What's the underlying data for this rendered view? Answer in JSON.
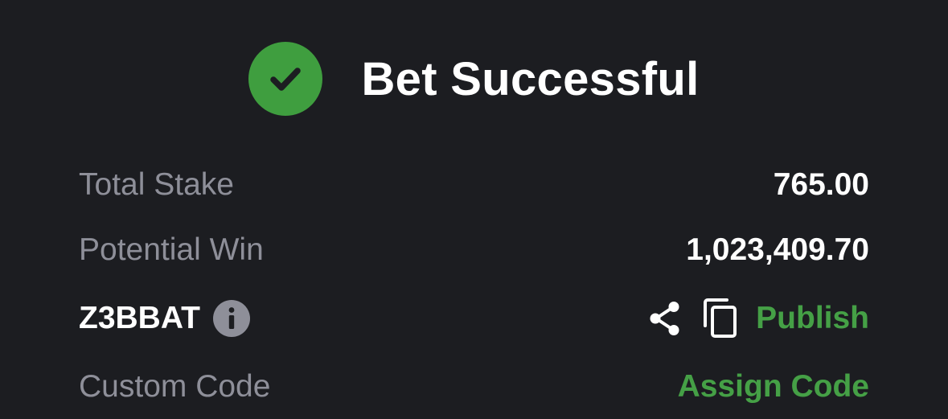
{
  "header": {
    "title": "Bet Successful",
    "icon": "check-circle-icon",
    "icon_color": "#3f9e3f"
  },
  "summary": {
    "total_stake_label": "Total Stake",
    "total_stake_value": "765.00",
    "potential_win_label": "Potential Win",
    "potential_win_value": "1,023,409.70"
  },
  "booking": {
    "code": "Z3BBAT",
    "info_icon": "info-icon",
    "share_icon": "share-icon",
    "copy_icon": "copy-icon",
    "publish_label": "Publish"
  },
  "custom_code": {
    "label": "Custom Code",
    "action_label": "Assign Code"
  },
  "colors": {
    "background": "#1c1d21",
    "muted_text": "#8e8f99",
    "accent_green": "#45a046"
  }
}
